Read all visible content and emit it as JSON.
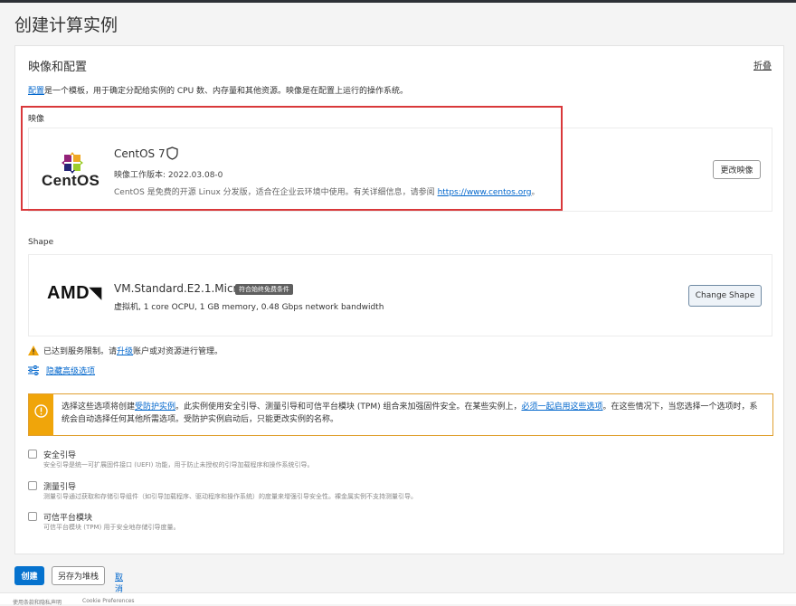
{
  "page": {
    "title": "创建计算实例"
  },
  "section": {
    "title": "映像和配置",
    "collapse_label": "折叠",
    "desc_link": "配置",
    "desc_rest": "是一个模板，用于确定分配给实例的 CPU 数、内存量和其他资源。映像是在配置上运行的操作系统。"
  },
  "image": {
    "label": "映像",
    "logo_text": "CentOS",
    "name": "CentOS 7",
    "build": "映像工作版本: 2022.03.08-0",
    "desc": "CentOS 是免费的开源 Linux 分发版，适合在企业云环境中使用。有关详细信息，请参阅",
    "link": "https://www.centos.org",
    "link_suffix": "。",
    "change_button": "更改映像"
  },
  "shape": {
    "label": "Shape",
    "logo_text": "AMD",
    "name": "VM.Standard.E2.1.Micro",
    "badge": "符合始终免费条件",
    "spec": "虚拟机, 1 core OCPU, 1 GB memory, 0.48 Gbps network bandwidth",
    "change_button": "Change Shape"
  },
  "limit_warning": {
    "text_before": "已达到服务限制。请",
    "link": "升级",
    "text_after": "账户或对资源进行管理。"
  },
  "advanced_options_link": "隐藏高级选项",
  "notice": {
    "part1": "选择这些选项将创建",
    "link1": "受防护实例",
    "part2": "。此实例使用安全引导、测量引导和可信平台模块 (TPM) 组合来加强固件安全。在某些实例上，",
    "link2": "必须一起启用这些选项",
    "part3": "。在这些情况下，当您选择一个选项时，系统会自动选择任何其他所需选项。受防护实例启动后，只能更改实例的名称。"
  },
  "options": [
    {
      "label": "安全引导",
      "desc": "安全引导是统一可扩展固件接口 (UEFI) 功能，用于防止未授权的引导加载程序和操作系统引导。",
      "checked": false
    },
    {
      "label": "测量引导",
      "desc": "测量引导通过获取和存储引导组件（如引导加载程序、驱动程序和操作系统）的度量来增强引导安全性。裸金属实例不支持测量引导。",
      "checked": false
    },
    {
      "label": "可信平台模块",
      "desc": "可信平台模块 (TPM) 用于安全地存储引导度量。",
      "checked": false
    }
  ],
  "actions": {
    "create": "创建",
    "save_stack": "另存为堆栈",
    "cancel": "取消"
  },
  "footer": {
    "terms": "使用条款和隐私声明",
    "cookie": "Cookie Preferences"
  },
  "colors": {
    "accent": "#0572ce",
    "highlight_border": "#d9383a",
    "notice_bar": "#f0a50a"
  }
}
